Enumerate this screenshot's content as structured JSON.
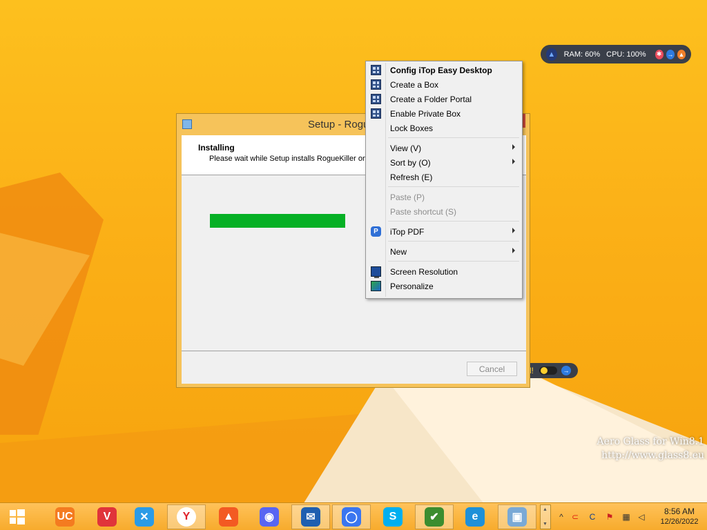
{
  "gadget": {
    "ram": "RAM: 60%",
    "cpu": "CPU: 100%"
  },
  "gadget2": {
    "text": "d!"
  },
  "setup": {
    "title": "Setup - Rogu",
    "heading": "Installing",
    "subtext": "Please wait while Setup installs RogueKiller on y",
    "progress_fraction": 0.47,
    "cancel_label": "Cancel"
  },
  "context_menu": {
    "items": [
      {
        "label": "Config iTop Easy Desktop",
        "icon": "itop-box-icon",
        "bold": true
      },
      {
        "label": "Create a Box",
        "icon": "itop-box-icon"
      },
      {
        "label": "Create a Folder Portal",
        "icon": "itop-box-icon"
      },
      {
        "label": "Enable Private Box",
        "icon": "itop-box-icon"
      },
      {
        "label": "Lock Boxes"
      },
      {
        "label": "View (V)",
        "submenu": true
      },
      {
        "label": "Sort by (O)",
        "submenu": true
      },
      {
        "label": "Refresh (E)"
      },
      {
        "label": "Paste (P)",
        "disabled": true
      },
      {
        "label": "Paste shortcut (S)",
        "disabled": true
      },
      {
        "label": "iTop PDF",
        "icon": "itop-pdf-icon",
        "submenu": true
      },
      {
        "label": "New",
        "submenu": true
      },
      {
        "label": "Screen Resolution",
        "icon": "monitor-icon"
      },
      {
        "label": "Personalize",
        "icon": "personalize-icon"
      }
    ]
  },
  "watermark": {
    "line1": "Aero Glass for Win8.1",
    "line2": "http://www.glass8.eu"
  },
  "taskbar": {
    "apps": [
      {
        "name": "uc-browser-icon",
        "glyph": "UC",
        "color": "#f47b20"
      },
      {
        "name": "vivaldi-icon",
        "glyph": "V",
        "color": "#e0343a"
      },
      {
        "name": "maxthon-icon",
        "glyph": "✕",
        "color": "#2b9be6"
      },
      {
        "name": "yandex-browser-icon",
        "glyph": "Y",
        "color": "#ffffff"
      },
      {
        "name": "brave-icon",
        "glyph": "▲",
        "color": "#f35a22"
      },
      {
        "name": "discord-icon",
        "glyph": "◉",
        "color": "#5865f2"
      },
      {
        "name": "thunderbird-icon",
        "glyph": "✉",
        "color": "#1f5fb0"
      },
      {
        "name": "signal-icon",
        "glyph": "◯",
        "color": "#3a76f0"
      },
      {
        "name": "skype-icon",
        "glyph": "S",
        "color": "#00aff0"
      },
      {
        "name": "security-check-icon",
        "glyph": "✔",
        "color": "#3c8d2f"
      },
      {
        "name": "internet-explorer-icon",
        "glyph": "e",
        "color": "#1e90d8"
      },
      {
        "name": "installer-icon",
        "glyph": "▣",
        "color": "#7aa9d6"
      }
    ],
    "clock_time": "8:56 AM",
    "clock_date": "12/26/2022"
  }
}
